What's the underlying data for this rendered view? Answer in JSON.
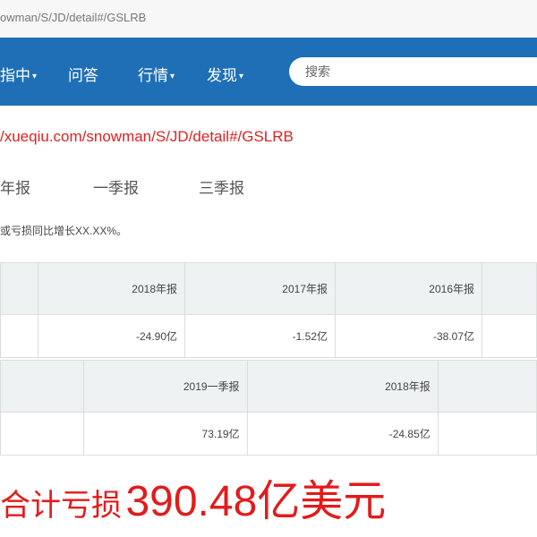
{
  "browser": {
    "url": "owman/S/JD/detail#/GSLRB"
  },
  "nav": {
    "items": [
      {
        "label": "指中",
        "has_caret": true
      },
      {
        "label": "问答",
        "has_caret": false
      },
      {
        "label": "行情",
        "has_caret": true
      },
      {
        "label": "发现",
        "has_caret": true
      }
    ],
    "search_placeholder": "搜索"
  },
  "page": {
    "link_text": "/xueqiu.com/snowman/S/JD/detail#/GSLRB",
    "tabs": [
      "年报",
      "一季报",
      "三季报"
    ],
    "note": "或亏损同比增长XX.XX%。"
  },
  "table_a": {
    "headers": [
      "",
      "2018年报",
      "2017年报",
      "2016年报",
      ""
    ],
    "values": [
      "",
      "-24.90亿",
      "-1.52亿",
      "-38.07亿",
      ""
    ]
  },
  "table_b": {
    "headers": [
      "",
      "2019一季报",
      "2018年报",
      ""
    ],
    "values": [
      "",
      "73.19亿",
      "-24.85亿",
      ""
    ]
  },
  "caption": {
    "text": "合计亏损",
    "amount": "390.48亿美元"
  },
  "colors": {
    "nav_bg": "#1f6fb6",
    "accent_red": "#e21b1b",
    "table_header_bg": "#eef2f3"
  }
}
